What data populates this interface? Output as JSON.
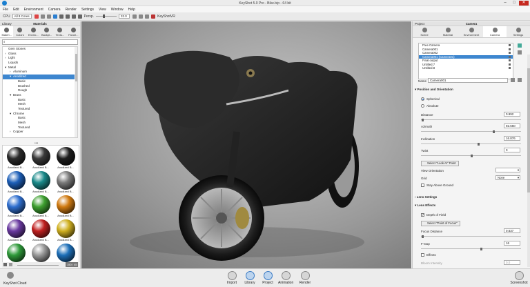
{
  "window": {
    "title": "KeyShot 5.0 Pro - Bike.bip - 64 bit"
  },
  "menu": [
    "File",
    "Edit",
    "Environment",
    "Camera",
    "Render",
    "Settings",
    "View",
    "Window",
    "Help"
  ],
  "toolbar": {
    "cpu_label": "CPU",
    "cpu_value": "All 8 Cores",
    "persp_label": "Persp.",
    "fov_value": "32.0",
    "keyshotvr_label": "KeyShotVR"
  },
  "left": {
    "header_left": "Library",
    "header_center": "Materials",
    "tabs": [
      "Materi...",
      "Colors",
      "Enviro...",
      "Backpl...",
      "Textu...",
      "Favori..."
    ],
    "search_placeholder": "",
    "tree": [
      {
        "label": "Gem Stones",
        "indent": 0,
        "arrow": ""
      },
      {
        "label": "Glass",
        "indent": 0,
        "arrow": "›"
      },
      {
        "label": "Light",
        "indent": 0,
        "arrow": "›"
      },
      {
        "label": "Liquids",
        "indent": 0,
        "arrow": ""
      },
      {
        "label": "Metal",
        "indent": 0,
        "arrow": "▾"
      },
      {
        "label": "Aluminum",
        "indent": 1,
        "arrow": "›"
      },
      {
        "label": "Anodized",
        "indent": 1,
        "arrow": "▾",
        "selected": true
      },
      {
        "label": "Basic",
        "indent": 2,
        "arrow": ""
      },
      {
        "label": "Brushed",
        "indent": 2,
        "arrow": ""
      },
      {
        "label": "Rough",
        "indent": 2,
        "arrow": ""
      },
      {
        "label": "Brass",
        "indent": 1,
        "arrow": "▾"
      },
      {
        "label": "Basic",
        "indent": 2,
        "arrow": ""
      },
      {
        "label": "Mesh",
        "indent": 2,
        "arrow": ""
      },
      {
        "label": "Textured",
        "indent": 2,
        "arrow": ""
      },
      {
        "label": "Chrome",
        "indent": 1,
        "arrow": "▾"
      },
      {
        "label": "Basic",
        "indent": 2,
        "arrow": ""
      },
      {
        "label": "Mesh",
        "indent": 2,
        "arrow": ""
      },
      {
        "label": "Textured",
        "indent": 2,
        "arrow": ""
      },
      {
        "label": "Copper",
        "indent": 1,
        "arrow": "›"
      }
    ],
    "thumbs": [
      {
        "label": "Anodized B...",
        "color": "#2a2a2a"
      },
      {
        "label": "Anodized B...",
        "color": "#3a3a3a"
      },
      {
        "label": "Anodized B...",
        "color": "#1e1e1e"
      },
      {
        "label": "Anodized B...",
        "color": "#1d5fb8"
      },
      {
        "label": "Anodized B...",
        "color": "#1a8a8a"
      },
      {
        "label": "Anodized B...",
        "color": "#7a7a7a"
      },
      {
        "label": "Anodized B...",
        "color": "#2f6fcf"
      },
      {
        "label": "Anodized B...",
        "color": "#3ea030"
      },
      {
        "label": "Anodized B...",
        "color": "#d07a10"
      },
      {
        "label": "Anodized B...",
        "color": "#6a3aa0"
      },
      {
        "label": "Anodized B...",
        "color": "#c02020"
      },
      {
        "label": "Anodized B...",
        "color": "#d0b020"
      },
      {
        "label": "",
        "color": "#2f9a3a"
      },
      {
        "label": "",
        "color": "#9a9a9a"
      },
      {
        "label": "",
        "color": "#1d6fb8"
      }
    ],
    "footer_value": "150 / 45"
  },
  "right": {
    "header_left": "Project",
    "header_center": "Camera",
    "tabs": [
      "Scene",
      "Material",
      "Environment",
      "Camera",
      "Settings"
    ],
    "cameras": [
      "Free Camera",
      "Camera001",
      "Camera002",
      "Camera001 (Camera01)",
      "Final output",
      "Untitled.7",
      "Untitled.8"
    ],
    "name_label": "Name",
    "name_value": "Camera001",
    "pos_section": "Position and Orientation",
    "spherical": "Spherical",
    "absolute": "Absolute",
    "distance_label": "Distance",
    "distance_value": "0.992",
    "azimuth_label": "Azimuth",
    "azimuth_value": "92.660",
    "inclination_label": "Inclination",
    "inclination_value": "16.876",
    "twist_label": "Twist",
    "twist_value": "0",
    "lookat_btn": "Select \"Look At\" Point",
    "view_orient_label": "View Orientation",
    "view_orient_value": "",
    "grid_label": "Grid",
    "grid_value": "None",
    "stay_above": "Stay Above Ground",
    "lens_settings": "Lens Settings",
    "lens_effects": "Lens Effects",
    "dof_label": "Depth of Field",
    "pof_btn": "Select \"Point of Focus\"",
    "focus_label": "Focus Distance",
    "focus_value": "0.637",
    "fstop_label": "F-stop",
    "fstop_value": "16",
    "effects_label": "Effects",
    "bloom_label": "Bloom Intensity",
    "bloom_value": "0.0"
  },
  "bottom": {
    "cloud": "KeyShot Cloud",
    "items": [
      "Import",
      "Library",
      "Project",
      "Animation",
      "Render"
    ],
    "screenshot": "Screenshot"
  }
}
